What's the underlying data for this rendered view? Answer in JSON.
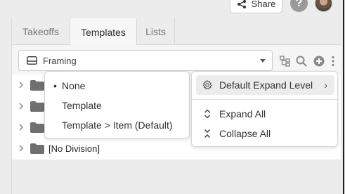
{
  "header": {
    "share_label": "Share",
    "help_label": "?"
  },
  "tabs": [
    {
      "label": "Takeoffs",
      "active": false
    },
    {
      "label": "Templates",
      "active": true
    },
    {
      "label": "Lists",
      "active": false
    }
  ],
  "toolbar": {
    "selected_value": "Framing"
  },
  "tree": {
    "items": [
      {
        "label": ""
      },
      {
        "label": ""
      },
      {
        "label": ""
      },
      {
        "label": "[No Division]"
      }
    ]
  },
  "group_menu": {
    "options": [
      {
        "label": "None",
        "selected": true
      },
      {
        "label": "Template",
        "selected": false
      },
      {
        "label": "Template > Item (Default)",
        "selected": false
      }
    ],
    "bullet": "•"
  },
  "expand_menu": {
    "default_expand_label": "Default Expand Level",
    "expand_all_label": "Expand All",
    "collapse_all_label": "Collapse All",
    "submenu_arrow": "›"
  },
  "colors": {
    "accent_bg": "#ececec",
    "folder": "#6f6f6f",
    "icon": "#8a8a8a"
  }
}
